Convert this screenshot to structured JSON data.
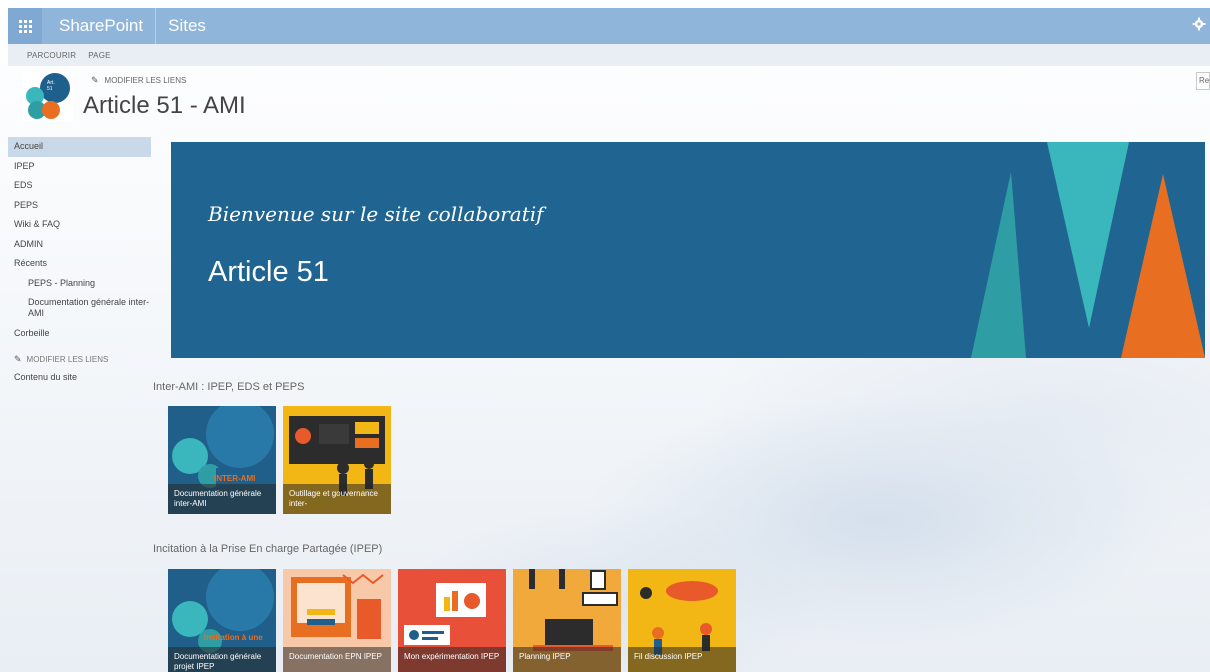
{
  "suitebar": {
    "brand": "SharePoint",
    "section": "Sites",
    "settings_icon": "gear-icon"
  },
  "ribbon": {
    "browse": "PARCOURIR",
    "page": "PAGE"
  },
  "header": {
    "edit_links": "MODIFIER LES LIENS",
    "title": "Article 51 - AMI",
    "search_text": "Rec"
  },
  "nav": {
    "items": [
      "Accueil",
      "IPEP",
      "EDS",
      "PEPS",
      "Wiki & FAQ",
      "ADMIN",
      "Récents"
    ],
    "recent": [
      "PEPS - Planning",
      "Documentation générale inter-AMI"
    ],
    "trash": "Corbeille",
    "edit_links": "MODIFIER LES LIENS",
    "site_contents": "Contenu du site"
  },
  "hero": {
    "subtitle": "Bienvenue sur le site collaboratif",
    "title": "Article 51",
    "colors": {
      "background": "#206591",
      "teal": "#2f9ea4",
      "cyan": "#3ab7bc",
      "orange": "#e86f21"
    }
  },
  "sections": {
    "inter_ami": {
      "title": "Inter-AMI : IPEP, EDS et PEPS",
      "tiles": [
        {
          "caption": "Documentation générale inter-AMI",
          "overlay": "INTER-AMI"
        },
        {
          "caption": "Outillage et gouvernance inter-"
        }
      ]
    },
    "ipep": {
      "title": "Incitation à la Prise En charge Partagée (IPEP)",
      "tiles": [
        {
          "caption": "Documentation générale projet IPEP",
          "overlay": "Incitation à une"
        },
        {
          "caption": "Documentation EPN IPEP"
        },
        {
          "caption": "Mon expérimentation IPEP"
        },
        {
          "caption": "Planning IPEP"
        },
        {
          "caption": "Fil discussion IPEP"
        }
      ]
    }
  }
}
